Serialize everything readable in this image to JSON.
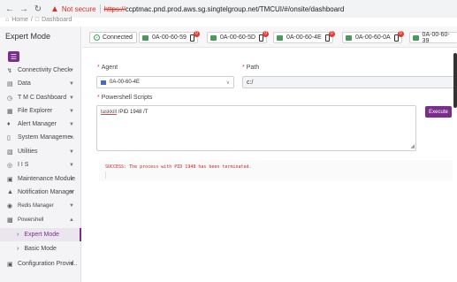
{
  "browser": {
    "not_secure": "Not secure",
    "url_scheme": "https://",
    "url_rest": "ccptmac.pnd.prod.aws.sg.singtelgroup.net/TMCUI/#/onsite/dashboard"
  },
  "breadcrumb": {
    "home": "Home",
    "separator": "/",
    "current": "Dashboard"
  },
  "sidebar": {
    "title": "Expert Mode",
    "items": [
      {
        "label": "Connectivity Check",
        "icon": "plug-icon"
      },
      {
        "label": "Data",
        "icon": "data-icon"
      },
      {
        "label": "T M C Dashboard",
        "icon": "clock-icon"
      },
      {
        "label": "File Explorer",
        "icon": "folder-icon"
      },
      {
        "label": "Alert Manager",
        "icon": "bell-icon"
      },
      {
        "label": "System Manageme..",
        "icon": "doc-icon"
      },
      {
        "label": "Utilities",
        "icon": "tools-icon"
      },
      {
        "label": "I I S",
        "icon": "globe-icon"
      },
      {
        "label": "Maintenance Module",
        "icon": "db-icon"
      },
      {
        "label": "Notification Manager",
        "icon": "notification-icon"
      },
      {
        "label": "Redis Manager",
        "icon": "redis-icon"
      },
      {
        "label": "Powershell",
        "icon": "powershell-icon"
      }
    ],
    "sub_items": [
      {
        "label": "Expert Mode"
      },
      {
        "label": "Basic Mode"
      }
    ],
    "bottom_item": {
      "label": "Configuration Provid..",
      "icon": "lock-icon"
    }
  },
  "tabbar": {
    "connected": "Connected",
    "devices": [
      {
        "mac": "0A-00-60-59",
        "badge": "0"
      },
      {
        "mac": "0A-00-60-5D",
        "badge": "0"
      },
      {
        "mac": "0A-00-60-4E",
        "badge": "0"
      },
      {
        "mac": "0A-00-60-0A",
        "badge": "0"
      },
      {
        "mac": "0A-00-60-39",
        "badge": ""
      }
    ]
  },
  "form": {
    "agent_label": "Agent",
    "agent_value": "0A-00-60-4E",
    "path_label": "Path",
    "path_value": "c:/",
    "scripts_label": "Powershell Scripts",
    "script_cmd": "taskkill",
    "script_args": " /PID 1948 /T",
    "execute_label": "Execute"
  },
  "output": {
    "message": "SUCCESS: The process with PID 1948 has been terminated."
  },
  "colors": {
    "accent": "#7b2d8e",
    "error": "#d93025",
    "success": "#3aa655"
  }
}
